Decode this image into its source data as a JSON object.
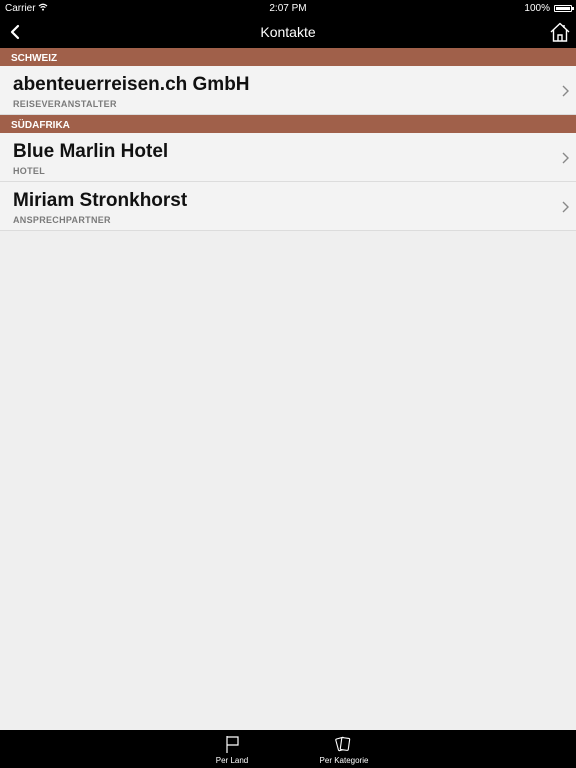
{
  "status_bar": {
    "carrier": "Carrier",
    "time": "2:07 PM",
    "battery": "100%"
  },
  "nav": {
    "title": "Kontakte",
    "back_icon": "chevron-left-icon",
    "home_icon": "home-icon"
  },
  "sections": [
    {
      "header": "SCHWEIZ",
      "rows": [
        {
          "title": "abenteuerreisen.ch GmbH",
          "subtitle": "REISEVERANSTALTER"
        }
      ]
    },
    {
      "header": "SÜDAFRIKA",
      "rows": [
        {
          "title": "Blue Marlin Hotel",
          "subtitle": "HOTEL"
        },
        {
          "title": "Miriam Stronkhorst",
          "subtitle": "ANSPRECHPARTNER"
        }
      ]
    }
  ],
  "tab_bar": {
    "tabs": [
      {
        "label": "Per Land",
        "icon": "flag-icon"
      },
      {
        "label": "Per Kategorie",
        "icon": "cards-icon"
      }
    ]
  },
  "colors": {
    "section_header": "#a0604a",
    "bar_background": "#000000",
    "content_background": "#efefef"
  }
}
